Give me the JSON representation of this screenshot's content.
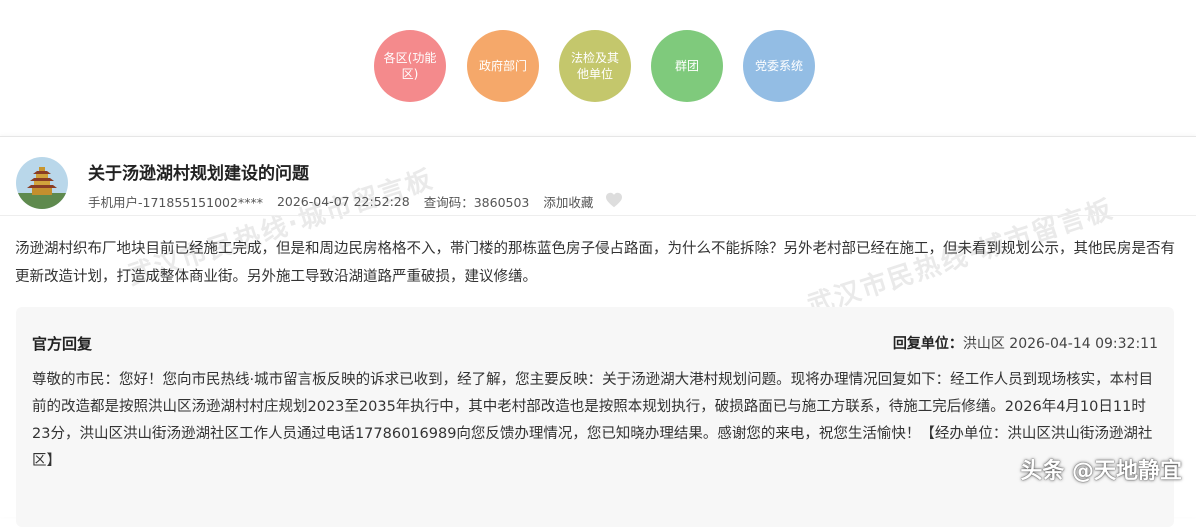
{
  "nav": {
    "items": [
      {
        "label": "各区(功能区)",
        "color": "#f48a8c"
      },
      {
        "label": "政府部门",
        "color": "#f5a86a"
      },
      {
        "label": "法检及其他单位",
        "color": "#c4c76c"
      },
      {
        "label": "群团",
        "color": "#7fca7c"
      },
      {
        "label": "党委系统",
        "color": "#93bde4"
      }
    ]
  },
  "post": {
    "title": "关于汤逊湖村规划建设的问题",
    "user": "手机用户-171855151002****",
    "datetime": "2026-04-07 22:52:28",
    "query_code": "查询码：3860503",
    "favorite": "添加收藏",
    "content": "汤逊湖村织布厂地块目前已经施工完成，但是和周边民房格格不入，帯门楼的那栋蓝色房子侵占路面，为什么不能拆除？另外老村部已经在施工，但未看到规划公示，其他民房是否有更新改造计划，打造成整体商业街。另外施工导致沿湖道路严重破损，建议修缮。"
  },
  "reply": {
    "label": "官方回复",
    "unit_label": "回复单位：",
    "unit": "洪山区",
    "datetime": "2026-04-14 09:32:11",
    "content": "尊敬的市民：您好！您向市民热线·城市留言板反映的诉求已收到，经了解，您主要反映：关于汤逊湖大港村规划问题。现将办理情况回复如下：经工作人员到现场核实，本村目前的改造都是按照洪山区汤逊湖村村庄规划2023至2035年执行中，其中老村部改造也是按照本规划执行，破损路面已与施工方联系，待施工完后修缮。2026年4月10日11时23分，洪山区洪山街汤逊湖社区工作人员通过电话17786016989向您反馈办理情况，您已知晓办理结果。感谢您的来电，祝您生活愉快！【经办单位：洪山区洪山街汤逊湖社区】"
  },
  "watermarks": {
    "w1": "武汉市民热线·城市留言板",
    "w2": "武汉市民热线·城市留言板"
  },
  "footer": {
    "source": "头条 @天地静宜"
  }
}
